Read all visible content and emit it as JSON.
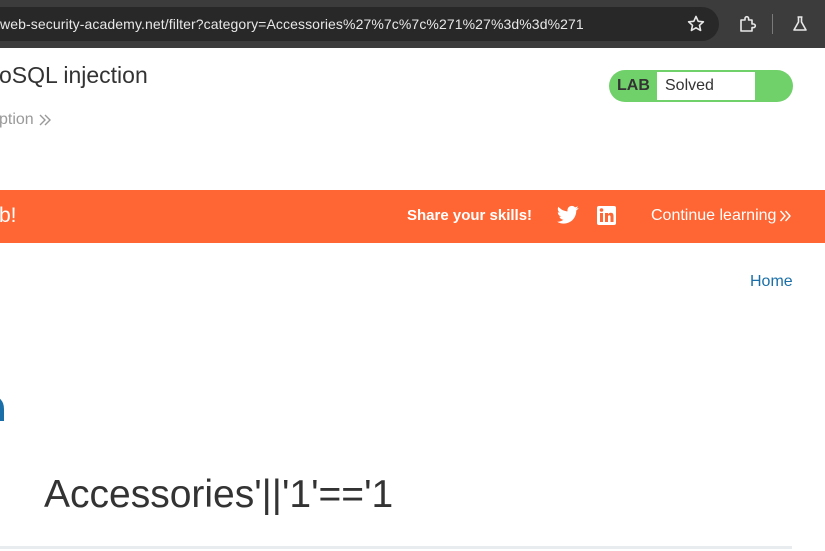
{
  "browser": {
    "url": "web-security-academy.net/filter?category=Accessories%27%7c%7c%271%27%3d%3d%271",
    "icons": [
      "star-icon",
      "extensions-icon",
      "labs-flask-icon"
    ]
  },
  "lab": {
    "title": "oSQL injection",
    "back_link": "ption",
    "badge_label": "LAB",
    "status": "Solved",
    "colors": {
      "badge": "#70d16a"
    }
  },
  "banner": {
    "message": "b!",
    "share_text": "Share your skills!",
    "continue_label": "Continue learning",
    "colors": {
      "background": "#ff6633"
    }
  },
  "nav": {
    "home_label": "Home"
  },
  "main": {
    "category_heading": "Accessories'||'1'=='1"
  }
}
